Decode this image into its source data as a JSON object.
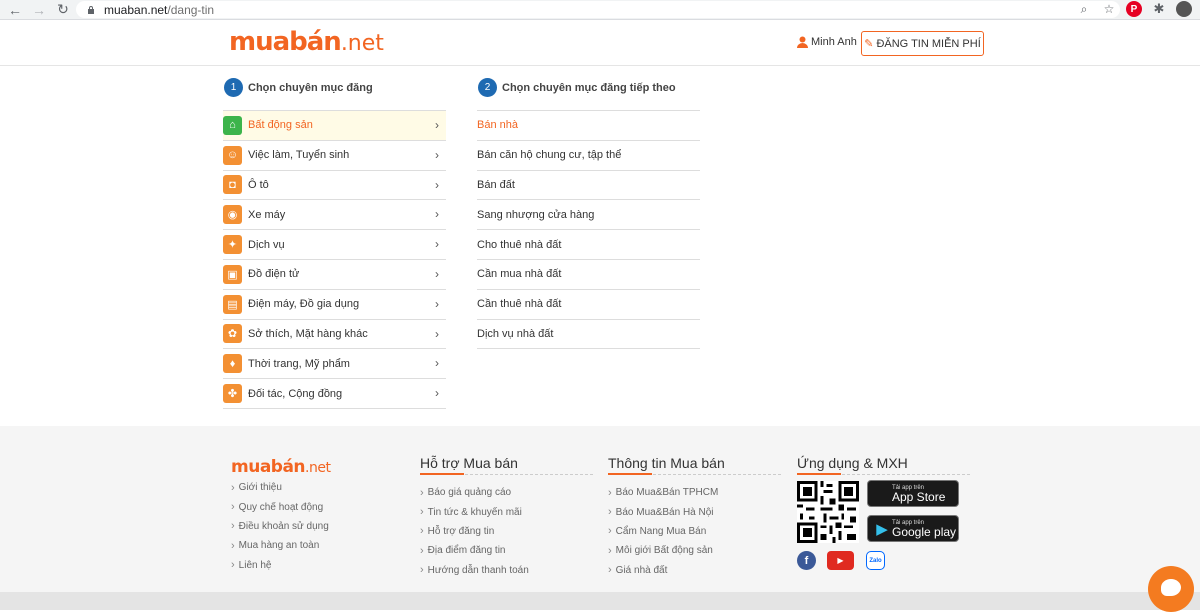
{
  "browser": {
    "url_host": "muaban.net",
    "url_path": "/dang-tin"
  },
  "header": {
    "logo_main": "muabán",
    "logo_tld": ".net",
    "user_name": "Minh Anh",
    "post_button": "ĐĂNG TIN MIỄN PHÍ"
  },
  "steps": {
    "step1_num": "1",
    "step1_label": "Chọn chuyên mục đăng",
    "step2_num": "2",
    "step2_label": "Chọn chuyên mục đăng tiếp theo"
  },
  "categories": [
    {
      "label": "Bất động sản",
      "icon": "house-icon",
      "glyph": "⌂",
      "active": true
    },
    {
      "label": "Việc làm, Tuyển sinh",
      "icon": "people-icon",
      "glyph": "☺"
    },
    {
      "label": "Ô tô",
      "icon": "car-icon",
      "glyph": "◘"
    },
    {
      "label": "Xe máy",
      "icon": "motorbike-icon",
      "glyph": "◉"
    },
    {
      "label": "Dịch vụ",
      "icon": "service-icon",
      "glyph": "✦"
    },
    {
      "label": "Đồ điện tử",
      "icon": "electronics-icon",
      "glyph": "▣"
    },
    {
      "label": "Điện máy, Đồ gia dụng",
      "icon": "appliance-icon",
      "glyph": "▤"
    },
    {
      "label": "Sở thích, Mặt hàng khác",
      "icon": "hobby-icon",
      "glyph": "✿"
    },
    {
      "label": "Thời trang, Mỹ phẩm",
      "icon": "fashion-icon",
      "glyph": "♦"
    },
    {
      "label": "Đối tác, Cộng đồng",
      "icon": "handshake-icon",
      "glyph": "✤"
    }
  ],
  "subcategories": [
    {
      "label": "Bán nhà",
      "active": true
    },
    {
      "label": "Bán căn hộ chung cư, tập thể"
    },
    {
      "label": "Bán đất"
    },
    {
      "label": "Sang nhượng cửa hàng"
    },
    {
      "label": "Cho thuê nhà đất"
    },
    {
      "label": "Cần mua nhà đất"
    },
    {
      "label": "Cần thuê nhà đất"
    },
    {
      "label": "Dịch vụ nhà đất"
    }
  ],
  "footer": {
    "logo_main": "muabán",
    "logo_tld": ".net",
    "col1": {
      "items": [
        "Giới thiệu",
        "Quy chế hoạt động",
        "Điều khoản sử dụng",
        "Mua hàng an toàn",
        "Liên hệ"
      ]
    },
    "col2": {
      "title": "Hỗ trợ Mua bán",
      "items": [
        "Báo giá quảng cáo",
        "Tin tức & khuyến mãi",
        "Hỗ trợ đăng tin",
        "Địa điểm đăng tin",
        "Hướng dẫn thanh toán"
      ]
    },
    "col3": {
      "title": "Thông tin Mua bán",
      "items": [
        "Báo Mua&Bán TPHCM",
        "Báo Mua&Bán Hà Nội",
        "Cẩm Nang Mua Bán",
        "Môi giới Bất động sản",
        "Giá nhà đất"
      ]
    },
    "col4": {
      "title": "Ứng dụng & MXH"
    },
    "appstore": {
      "small": "Tải app trên",
      "big": "App Store"
    },
    "googleplay": {
      "small": "Tải app trên",
      "big": "Google play"
    },
    "zalo": "Zalo"
  },
  "colors": {
    "brand": "#f26522",
    "step_badge": "#1e6ab2",
    "active_bg": "#fffbe6"
  }
}
